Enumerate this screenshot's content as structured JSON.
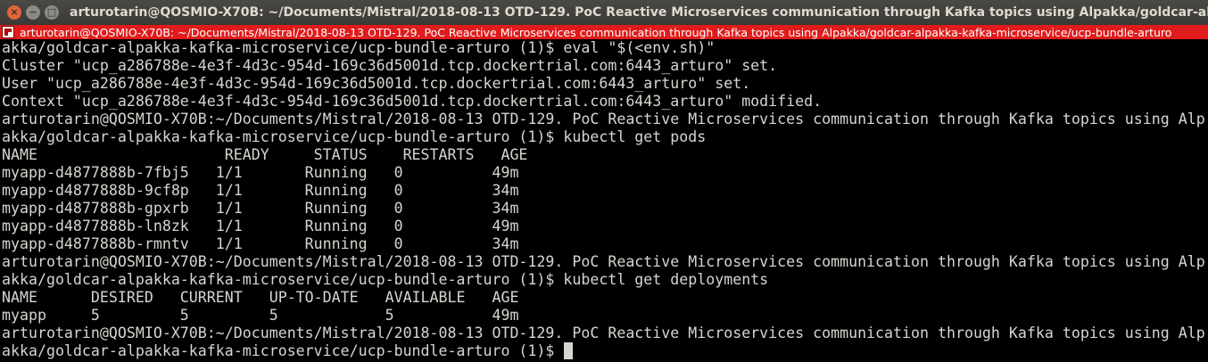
{
  "window": {
    "title": "arturotarin@QOSMIO-X70B: ~/Documents/Mistral/2018-08-13 OTD-129. PoC Reactive Microservices communication through Kafka topics using Alpakka/goldcar-alpakka-kafka-",
    "buttons": {
      "close": "×",
      "minimize": "−",
      "maximize": "□"
    }
  },
  "tab": {
    "label": "arturotarin@QOSMIO-X70B: ~/Documents/Mistral/2018-08-13 OTD-129. PoC Reactive Microservices communication through Kafka topics using Alpakka/goldcar-alpakka-kafka-microservice/ucp-bundle-arturo"
  },
  "colors": {
    "tab_bar": "#e01b1b",
    "terminal_bg": "#000000",
    "terminal_fg": "#d3d7cf",
    "title_bar": "#3c3b37"
  },
  "terminal": {
    "lines": [
      "akka/goldcar-alpakka-kafka-microservice/ucp-bundle-arturo (1)$ eval \"$(<env.sh)\"",
      "Cluster \"ucp_a286788e-4e3f-4d3c-954d-169c36d5001d.tcp.dockertrial.com:6443_arturo\" set.",
      "User \"ucp_a286788e-4e3f-4d3c-954d-169c36d5001d.tcp.dockertrial.com:6443_arturo\" set.",
      "Context \"ucp_a286788e-4e3f-4d3c-954d-169c36d5001d.tcp.dockertrial.com:6443_arturo\" modified.",
      "arturotarin@QOSMIO-X70B:~/Documents/Mistral/2018-08-13 OTD-129. PoC Reactive Microservices communication through Kafka topics using Alp",
      "akka/goldcar-alpakka-kafka-microservice/ucp-bundle-arturo (1)$ kubectl get pods",
      "NAME                     READY     STATUS    RESTARTS   AGE",
      "myapp-d4877888b-7fbj5   1/1       Running   0          49m",
      "myapp-d4877888b-9cf8p   1/1       Running   0          34m",
      "myapp-d4877888b-gpxrb   1/1       Running   0          34m",
      "myapp-d4877888b-ln8zk   1/1       Running   0          49m",
      "myapp-d4877888b-rmntv   1/1       Running   0          34m",
      "arturotarin@QOSMIO-X70B:~/Documents/Mistral/2018-08-13 OTD-129. PoC Reactive Microservices communication through Kafka topics using Alp",
      "akka/goldcar-alpakka-kafka-microservice/ucp-bundle-arturo (1)$ kubectl get deployments",
      "NAME      DESIRED   CURRENT   UP-TO-DATE   AVAILABLE   AGE",
      "myapp     5         5         5            5           49m",
      "arturotarin@QOSMIO-X70B:~/Documents/Mistral/2018-08-13 OTD-129. PoC Reactive Microservices communication through Kafka topics using Alp",
      "akka/goldcar-alpakka-kafka-microservice/ucp-bundle-arturo (1)$ "
    ]
  }
}
